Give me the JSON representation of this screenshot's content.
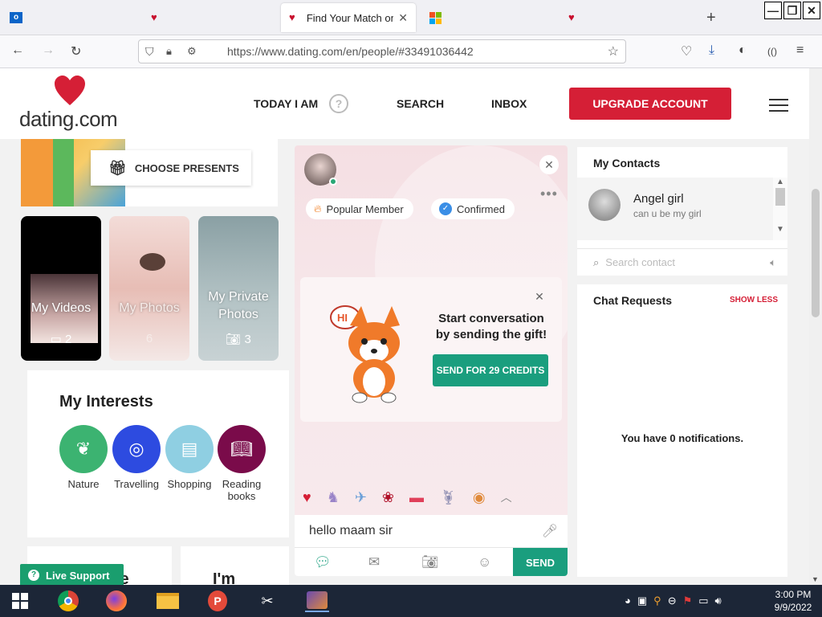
{
  "browser": {
    "tabs": [
      {
        "label": "",
        "icon": "outlook-icon"
      },
      {
        "label": "",
        "icon": "heart-icon"
      },
      {
        "label": "Find Your Match on D",
        "icon": "heart-icon"
      },
      {
        "label": "",
        "icon": "microsoft-icon"
      },
      {
        "label": "",
        "icon": "heart-icon"
      }
    ],
    "new_tab": "+",
    "url": "https://www.dating.com/en/people/#33491036442"
  },
  "site": {
    "logo_text": "dating.com",
    "nav": {
      "today": "TODAY I AM",
      "help": "?",
      "search": "SEARCH",
      "inbox": "INBOX",
      "upgrade": "UPGRADE ACCOUNT"
    }
  },
  "left": {
    "choose_presents": "CHOOSE PRESENTS",
    "photos": [
      {
        "label": "My Videos",
        "count": "2"
      },
      {
        "label": "My Photos",
        "count": "6"
      },
      {
        "label": "My Private Photos",
        "count": "3"
      }
    ],
    "interests_title": "My Interests",
    "interests": [
      {
        "label": "Nature",
        "color": "#3cb371"
      },
      {
        "label": "Travelling",
        "color": "#2d4be0"
      },
      {
        "label": "Shopping",
        "color": "#8fcfe2"
      },
      {
        "label": "Reading books",
        "color": "#7a0b4a"
      }
    ],
    "bottom_cards": [
      "le",
      "I'm"
    ],
    "live_support": "Live Support"
  },
  "chat": {
    "badges": {
      "popular": "Popular Member",
      "confirmed": "Confirmed"
    },
    "gift_prompt": "Start conversation by sending the gift!",
    "send_credits": "SEND FOR 29 CREDITS",
    "message": "hello maam sir",
    "send": "SEND"
  },
  "contacts": {
    "title": "My Contacts",
    "items": [
      {
        "name": "Angel girl",
        "preview": "can u be my girl"
      }
    ],
    "search_placeholder": "Search contact"
  },
  "requests": {
    "title": "Chat Requests",
    "toggle": "SHOW LESS",
    "empty": "You have 0 notifications."
  },
  "taskbar": {
    "time": "3:00 PM",
    "date": "9/9/2022"
  },
  "colors": {
    "brand_red": "#d51f36",
    "accent_green": "#1a9e7e",
    "live_green": "#1a9e6e"
  }
}
